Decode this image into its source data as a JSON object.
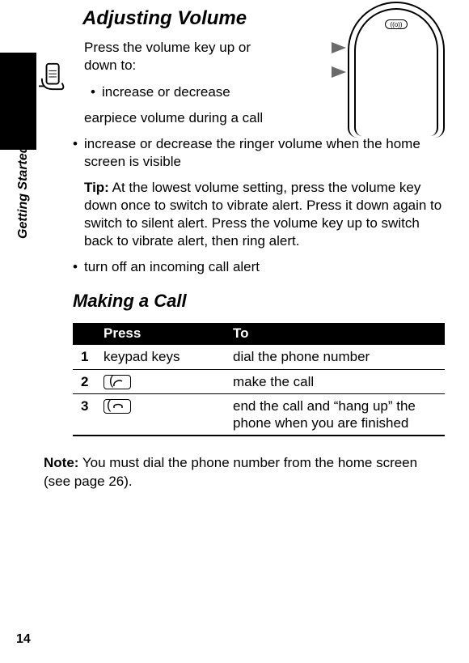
{
  "side_label": "Getting Started",
  "page_number": "14",
  "h1": "Adjusting Volume",
  "intro": "Press the volume key up or down to:",
  "b1_first": "increase or decrease",
  "b1_second": "earpiece volume during a call",
  "b2": "increase or decrease the ringer volume when the home screen is visible",
  "tip_label": "Tip:",
  "tip_text": " At the lowest volume setting, press the volume key down once to switch to vibrate alert. Press it down again to switch to silent alert. Press the volume key up to switch back to vibrate alert, then ring alert.",
  "b3": "turn off an incoming call alert",
  "h2": "Making a Call",
  "table": {
    "headers": [
      "",
      "Press",
      "To"
    ],
    "rows": [
      {
        "n": "1",
        "press": "keypad keys",
        "to": "dial the phone number"
      },
      {
        "n": "2",
        "press_icon": "talk-key",
        "to": "make the call"
      },
      {
        "n": "3",
        "press_icon": "end-key",
        "to": "end the call and “hang up” the phone when you are finished"
      }
    ]
  },
  "note_label": "Note:",
  "note_text": " You must dial the phone number from the home screen (see page 26)."
}
